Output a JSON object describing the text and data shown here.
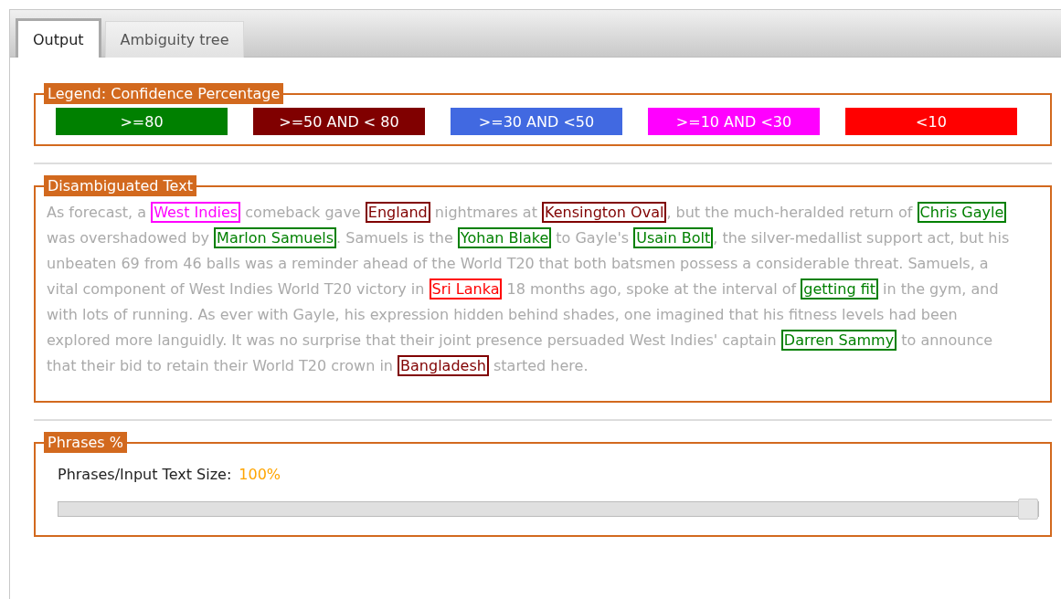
{
  "tabs": [
    {
      "label": "Output",
      "selected": true
    },
    {
      "label": "Ambiguity tree",
      "selected": false
    }
  ],
  "legend": {
    "title": "Legend: Confidence Percentage",
    "items": [
      {
        "label": ">=80",
        "color": "#008000"
      },
      {
        "label": ">=50 AND < 80",
        "color": "#800000"
      },
      {
        "label": ">=30 AND <50",
        "color": "#4169e1"
      },
      {
        "label": ">=10 AND <30",
        "color": "#ff00ff"
      },
      {
        "label": "<10",
        "color": "#ff0000"
      }
    ]
  },
  "disambiguated": {
    "title": "Disambiguated Text",
    "segments": [
      {
        "kind": "plain",
        "text": "As forecast, a "
      },
      {
        "kind": "entity",
        "text": "West Indies",
        "color": "#ff00ff"
      },
      {
        "kind": "plain",
        "text": " comeback gave "
      },
      {
        "kind": "entity",
        "text": "England",
        "color": "#800000"
      },
      {
        "kind": "plain",
        "text": " nightmares at "
      },
      {
        "kind": "entity",
        "text": "Kensington Oval",
        "color": "#800000"
      },
      {
        "kind": "plain",
        "text": ", but the much-heralded return of "
      },
      {
        "kind": "entity",
        "text": "Chris Gayle",
        "color": "#008000"
      },
      {
        "kind": "plain",
        "text": " was overshadowed by "
      },
      {
        "kind": "entity",
        "text": "Marlon Samuels",
        "color": "#008000"
      },
      {
        "kind": "plain",
        "text": ". Samuels is the "
      },
      {
        "kind": "entity",
        "text": "Yohan Blake",
        "color": "#008000"
      },
      {
        "kind": "plain",
        "text": " to Gayle's "
      },
      {
        "kind": "entity",
        "text": "Usain Bolt",
        "color": "#008000"
      },
      {
        "kind": "plain",
        "text": ", the silver-medallist support act, but his unbeaten 69 from 46 balls was a reminder ahead of the World T20 that both batsmen possess a considerable threat. Samuels, a vital component of West Indies World T20 victory in "
      },
      {
        "kind": "entity",
        "text": "Sri Lanka",
        "color": "#ff0000"
      },
      {
        "kind": "plain",
        "text": " 18 months ago, spoke at the interval of "
      },
      {
        "kind": "entity",
        "text": "getting fit",
        "color": "#008000"
      },
      {
        "kind": "plain",
        "text": " in the gym, and with lots of running. As ever with Gayle, his expression hidden behind shades, one imagined that his fitness levels had been explored more languidly. It was no surprise that their joint presence persuaded West Indies' captain "
      },
      {
        "kind": "entity",
        "text": "Darren Sammy",
        "color": "#008000"
      },
      {
        "kind": "plain",
        "text": " to announce that their bid to retain their World T20 crown in "
      },
      {
        "kind": "entity",
        "text": "Bangladesh",
        "color": "#800000"
      },
      {
        "kind": "plain",
        "text": " started here."
      }
    ]
  },
  "phrases": {
    "title": "Phrases %",
    "label": "Phrases/Input Text Size:",
    "value": "100%",
    "level": 1.0
  }
}
